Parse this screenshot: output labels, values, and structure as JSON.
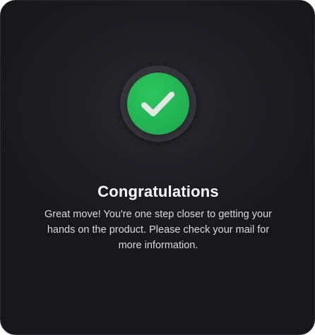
{
  "dialog": {
    "title": "Congratulations",
    "message": "Great move! You're one step closer to getting your hands on the product. Please check your mail for more information."
  },
  "icon": {
    "name": "checkmark-icon",
    "badge_color": "#22b553",
    "check_color": "#e6e6e6"
  },
  "colors": {
    "background": "#1d1d22",
    "ring": "#35353b",
    "text_primary": "#ffffff",
    "text_secondary": "#d9d9de"
  }
}
